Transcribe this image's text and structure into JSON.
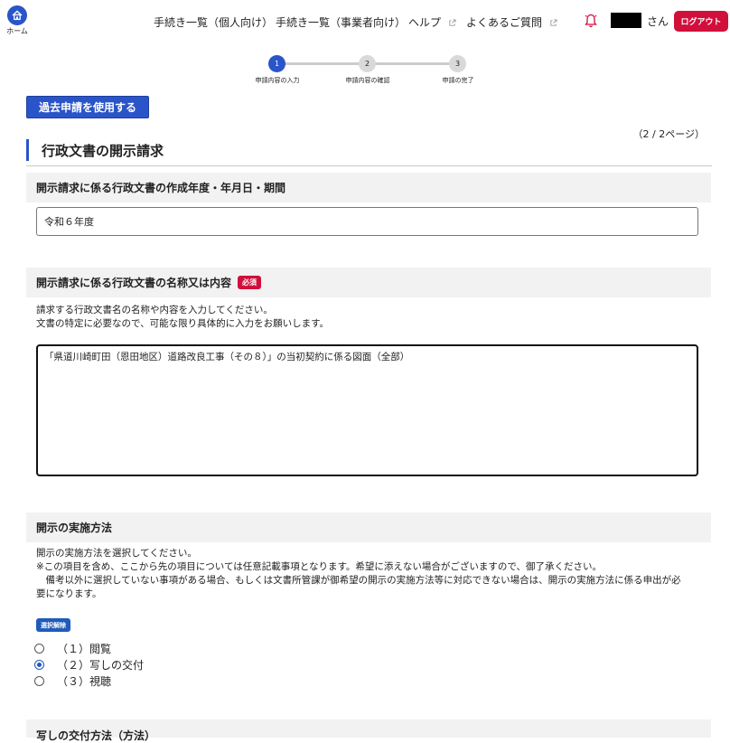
{
  "header": {
    "home_label": "ホーム",
    "nav": [
      {
        "label": "手続き一覧（個人向け）",
        "external": false
      },
      {
        "label": "手続き一覧（事業者向け）",
        "external": false
      },
      {
        "label": "ヘルプ",
        "external": true
      },
      {
        "label": "よくあるご質問",
        "external": true
      }
    ],
    "user_suffix": "さん",
    "logout_label": "ログアウト"
  },
  "stepper": {
    "steps": [
      {
        "number": "1",
        "label": "申請内容の入力",
        "state": "active"
      },
      {
        "number": "2",
        "label": "申請内容の確認",
        "state": "inactive"
      },
      {
        "number": "3",
        "label": "申請の完了",
        "state": "inactive"
      }
    ]
  },
  "past_application_button": "過去申請を使用する",
  "page_indicator": "（2 / 2ページ）",
  "page_title": "行政文書の開示請求",
  "sections": {
    "period": {
      "heading": "開示請求に係る行政文書の作成年度・年月日・期間",
      "value": "令和６年度"
    },
    "name": {
      "heading": "開示請求に係る行政文書の名称又は内容",
      "required_badge": "必須",
      "help_lines": [
        "請求する行政文書名の名称や内容を入力してください。",
        "文書の特定に必要なので、可能な限り具体的に入力をお願いします。"
      ],
      "value": "「県道川崎町田（恩田地区）道路改良工事（その８）」の当初契約に係る図面（全部）"
    },
    "method": {
      "heading": "開示の実施方法",
      "help_lines": [
        "開示の実施方法を選択してください。",
        "※この項目を含め、ここから先の項目については任意記載事項となります。希望に添えない場合がございますので、御了承ください。",
        "　備考以外に選択していない事項がある場合、もしくは文書所管課が御希望の開示の実施方法等に対応できない場合は、開示の実施方法に係る申出が必",
        "要になります。"
      ],
      "clear_label": "選択解除",
      "options": [
        {
          "label": "（１）閲覧",
          "checked": false
        },
        {
          "label": "（２）写しの交付",
          "checked": true
        },
        {
          "label": "（３）視聴",
          "checked": false
        }
      ]
    },
    "copy_method": {
      "heading": "写しの交付方法（方法）"
    }
  },
  "colors": {
    "primary": "#2a55c9",
    "danger": "#d10f3b",
    "section_bg": "#f2f2f2"
  }
}
